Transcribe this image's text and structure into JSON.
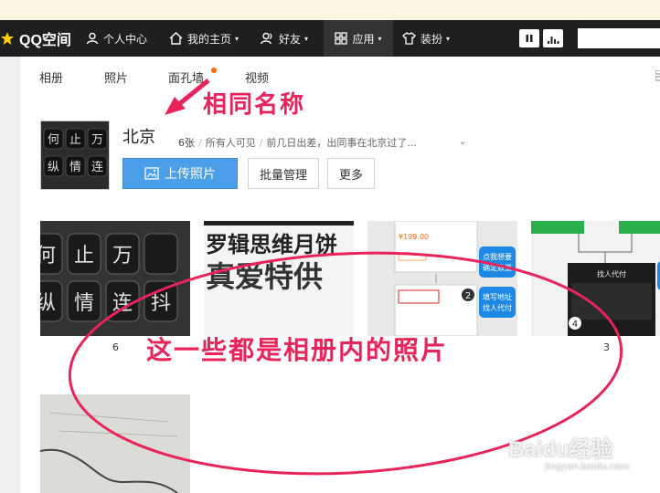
{
  "navbar": {
    "logo": "QQ空间",
    "items": [
      {
        "label": "个人中心"
      },
      {
        "label": "我的主页"
      },
      {
        "label": "好友"
      },
      {
        "label": "应用"
      },
      {
        "label": "装扮"
      }
    ],
    "caret": "▾"
  },
  "tabs": [
    "相册",
    "照片",
    "面孔墙",
    "视频"
  ],
  "album": {
    "title": "北京",
    "count": "6张",
    "visibility": "所有人可见",
    "description": "前几日出差，出同事在北京过了...",
    "separator": "/",
    "chevron": "⌄"
  },
  "buttons": {
    "upload": "上传照片",
    "batch": "批量管理",
    "more": "更多"
  },
  "photos": [
    {
      "label": "6"
    },
    {
      "label": ""
    },
    {
      "label": ""
    },
    {
      "label": "3"
    }
  ],
  "cover_text": [
    "何",
    "止",
    "万",
    "纵",
    "情",
    "连"
  ],
  "photo1_text": [
    "何",
    "止",
    "万",
    "纵",
    "情",
    "连",
    "抖"
  ],
  "photo2_text": {
    "line1": "罗辑思维月饼",
    "line2": "真爱特供"
  },
  "photo3_text": {
    "price": "¥199.00",
    "tag1": "点我想要",
    "tag2": "确定数量",
    "tag3": "填写地址",
    "tag4": "找人代付",
    "num": "2"
  },
  "photo4_text": {
    "title": "找人代付",
    "num": "4"
  },
  "annotations": {
    "same_name": "相同名称",
    "photos_in_album": "这一些都是相册内的照片",
    "color": "#e8245a"
  },
  "watermark": {
    "brand": "Baidu经验",
    "url": "jingyan.baidu.com"
  }
}
